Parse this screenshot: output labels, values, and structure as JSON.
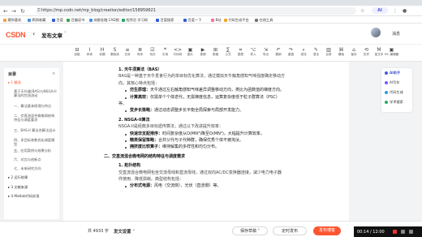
{
  "browser": {
    "url": "https://mp.csdn.net/mp_blog/creation/editor/158959621",
    "ai_label": "AI",
    "bookmarks": [
      {
        "label": "猜你喜欢",
        "color": "#f0a33c"
      },
      {
        "label": "爬网收藏",
        "color": "#4a90e2"
      },
      {
        "label": "百度",
        "color": "#2d5fdc"
      },
      {
        "label": "豆瓣读书",
        "color": "#3fa14a"
      },
      {
        "label": "成都金融 CAD图",
        "color": "#4a90e2"
      },
      {
        "label": "程序员 学习网",
        "color": "#2fa36b"
      },
      {
        "label": "百度搜索",
        "color": "#2d5fdc"
      },
      {
        "label": "百度一下",
        "color": "#2d5fdc"
      },
      {
        "label": "B站",
        "color": "#fb7299"
      },
      {
        "label": "代码生成平台",
        "color": "#f5a623"
      },
      {
        "label": "在线工具",
        "color": "#777777"
      }
    ]
  },
  "app": {
    "logo": "CSDN",
    "back_icon": "‹",
    "title": "发布文章",
    "user_label": "消息"
  },
  "toolbar": {
    "items": [
      {
        "icon": "⊟",
        "label": "加粗"
      },
      {
        "icon": "I",
        "label": "斜体"
      },
      {
        "icon": "H",
        "label": "标题"
      },
      {
        "icon": "S",
        "label": "删除线"
      },
      {
        "icon": "≡",
        "label": "无序"
      },
      {
        "icon": "≣",
        "label": "有序"
      },
      {
        "icon": "☑",
        "label": "待办"
      },
      {
        "icon": "❝",
        "label": "引用"
      },
      {
        "icon": "<>",
        "label": "代码块"
      },
      {
        "icon": "▣",
        "label": "图片"
      },
      {
        "icon": "▶",
        "label": "视频"
      },
      {
        "icon": "⊞",
        "label": "表格"
      },
      {
        "icon": "∑",
        "label": "公式"
      },
      {
        "icon": "⌗",
        "label": "图表"
      },
      {
        "icon": "⌥",
        "label": "导入"
      },
      {
        "icon": "⇲",
        "label": "导出"
      },
      {
        "icon": "↶",
        "label": "撤销"
      },
      {
        "icon": "↷",
        "label": "重做"
      },
      {
        "icon": "⌕",
        "label": "查找"
      },
      {
        "icon": "✎",
        "label": "语法"
      },
      {
        "icon": "▥",
        "label": "目录"
      },
      {
        "icon": "⌘",
        "label": "模版"
      },
      {
        "icon": "⌂",
        "label": "保存"
      },
      {
        "icon": "⟲",
        "label": "历史"
      },
      {
        "icon": "M",
        "label": "富文本"
      },
      {
        "icon": "▣",
        "label": "MC 编辑器"
      }
    ]
  },
  "outline": {
    "title": "目录",
    "close": "×",
    "items": [
      {
        "text": "▸ 1 概述",
        "active": true
      },
      {
        "text": "基于天升器(BAS)与NSGA-II算法的交流流动",
        "sub": true
      },
      {
        "text": "一、算法基本原理与特点",
        "sub": true
      },
      {
        "text": "二、交直流混合微电网结构特征与调度要求",
        "sub": true
      },
      {
        "text": "三、BAS-II 算法合算法设计",
        "sub": true
      },
      {
        "text": "四、多目标参数优化调度模型",
        "sub": true
      },
      {
        "text": "五、应用案例与效果分析",
        "sub": true
      },
      {
        "text": "六、对比与创新点",
        "sub": true
      },
      {
        "text": "七、未来研究方向",
        "sub": true
      },
      {
        "text": "▸ 2 运行结果",
        "sub": false
      },
      {
        "text": "▸ 3 文献来源",
        "sub": false
      },
      {
        "text": "▸ 4 Matlab代码实现",
        "sub": false
      }
    ]
  },
  "document": {
    "lines": [
      {
        "kind": "h",
        "text": "1. 天牛须算法（BAS）"
      },
      {
        "kind": "p",
        "text": "BAS是一种基于天牛觅食行为的单目标优化算法，通过模拟天牛触角感知气味强度确定移动方"
      },
      {
        "kind": "p",
        "text": "向，其核心特点包括："
      },
      {
        "kind": "li",
        "bold": "仿生原理：",
        "text": "天牛通过左右触角感知气味差异调整移动方向，类比为函数值的梯度方向。"
      },
      {
        "kind": "li",
        "bold": "计算高效：",
        "text": "仅需单个个体迭代，无需梯度信息，运算复杂度低于粒子群算法（PSC）"
      },
      {
        "kind": "p",
        "text": "等。"
      },
      {
        "kind": "li",
        "bold": "变步长策略：",
        "text": "通过动态调整步长平衡全局探索与局部开发能力。"
      },
      {
        "kind": "h",
        "text": "2. NSGA-II算法"
      },
      {
        "kind": "p",
        "text": "NSGA-II是经典多目标遗传算法，通过以下改进提升效率："
      },
      {
        "kind": "li",
        "bold": "快速非支配排序：",
        "text": "时间复杂度从O(MN³)降至O(MN²)，大幅提升计算效率。"
      },
      {
        "kind": "li",
        "bold": "精英保留策略：",
        "text": "合并父代与子代种群，确保优秀个体不被淘汰。"
      },
      {
        "kind": "li",
        "bold": "拥挤度比较算子：",
        "text": "维持解集的多样性和均匀分布。"
      },
      {
        "kind": "h",
        "text": "二、交直流混合微电网的结构特征与调度需求"
      },
      {
        "kind": "h",
        "text": "1. 拓扑结构"
      },
      {
        "kind": "p",
        "text": "交直流混合微电网包含交流母线和直流母线，通过双向AC/DC变换器连接，减少电力电子器"
      },
      {
        "kind": "p",
        "text": "件使用、降低损耗。典型结构包括："
      },
      {
        "kind": "li",
        "bold": "分布式电源：",
        "text": "风电（交流侧）、光伏（直流侧）等。"
      }
    ]
  },
  "right_panel": {
    "items": [
      {
        "label": "AI助手",
        "color": "#4b5ad8"
      },
      {
        "label": "AI写作",
        "color": "#7a5cff"
      },
      {
        "label": "代码生成",
        "color": "#2d9cdb"
      },
      {
        "label": "学术搜索",
        "color": "#27ae60"
      }
    ]
  },
  "bottom": {
    "word_count": "共 4933 字",
    "publish_settings": "发文设置 ˅",
    "save_draft": "保存草稿",
    "save_draft_caret": "˅",
    "schedule": "定时发布",
    "publish": "发布博客",
    "media_time": "00:14 / 12:00"
  }
}
